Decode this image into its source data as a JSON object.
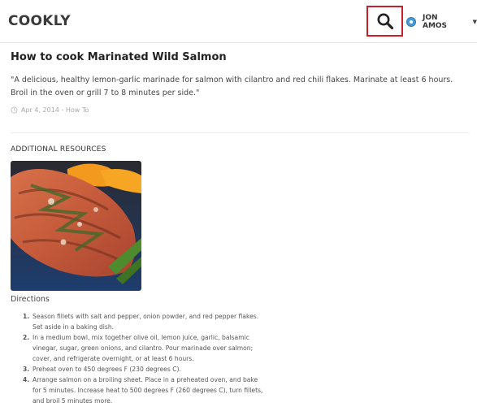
{
  "header": {
    "brand": "COOKLY",
    "search_icon": "search-icon",
    "user": {
      "name": "JON AMOS",
      "avatar_icon": "user-avatar-icon",
      "caret": "▼"
    }
  },
  "recipe": {
    "title": "How to cook Marinated Wild Salmon",
    "description": "\"A delicious, healthy lemon-garlic marinade for salmon with cilantro and red chili flakes. Marinate at least 6 hours. Broil in the oven or grill 7 to 8 minutes per side.\"",
    "meta": "Apr 4, 2014 - How To",
    "meta_icon": "clock-icon"
  },
  "resources": {
    "heading": "ADDITIONAL RESOURCES",
    "image_icon": "grilled-salmon-photo"
  },
  "directions": {
    "heading": "Directions",
    "steps": [
      {
        "num": "1.",
        "text": "Season fillets with salt and pepper, onion powder, and red pepper flakes. Set aside in a baking dish."
      },
      {
        "num": "2.",
        "text": "In a medium bowl, mix together olive oil, lemon juice, garlic, balsamic vinegar, sugar, green onions, and cilantro. Pour marinade over salmon; cover, and refrigerate overnight, or at least 6 hours."
      },
      {
        "num": "3.",
        "text": "Preheat oven to 450 degrees F (230 degrees C)."
      },
      {
        "num": "4.",
        "text": "Arrange salmon on a broiling sheet. Place in a preheated oven, and bake for 5 minutes. Increase heat to 500 degrees F (260 degrees C), turn fillets, and broil 5 minutes more."
      }
    ]
  },
  "colors": {
    "search_highlight": "#c8202a",
    "avatar": "#4a9ad6"
  }
}
